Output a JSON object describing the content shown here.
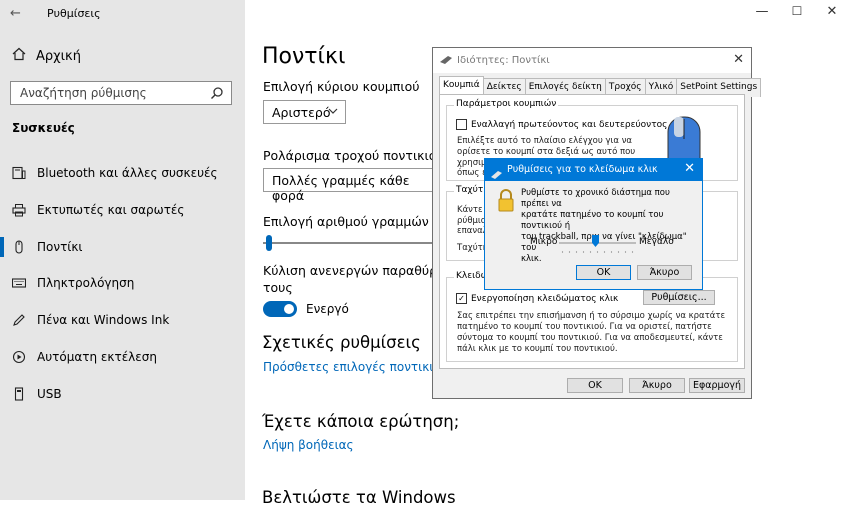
{
  "window": {
    "title": "Ρυθμίσεις",
    "controls": {
      "minimize": "—",
      "maximize": "☐",
      "close": "✕"
    }
  },
  "sidebar": {
    "home": "Αρχική",
    "search_placeholder": "Αναζήτηση ρύθμισης",
    "section": "Συσκευές",
    "items": [
      {
        "label": "Bluetooth και άλλες συσκευές",
        "icon": "bluetooth-devices-icon"
      },
      {
        "label": "Εκτυπωτές και σαρωτές",
        "icon": "printer-icon"
      },
      {
        "label": "Ποντίκι",
        "icon": "mouse-icon",
        "active": true
      },
      {
        "label": "Πληκτρολόγηση",
        "icon": "keyboard-icon"
      },
      {
        "label": "Πένα και Windows Ink",
        "icon": "pen-icon"
      },
      {
        "label": "Αυτόματη εκτέλεση",
        "icon": "autoplay-icon"
      },
      {
        "label": "USB",
        "icon": "usb-icon"
      }
    ]
  },
  "main": {
    "title": "Ποντίκι",
    "primary_button_label": "Επιλογή κύριου κουμπιού",
    "primary_button_value": "Αριστερό",
    "wheel_label": "Ρολάρισμα τροχού ποντικιού για",
    "wheel_value": "Πολλές γραμμές κάθε φορά",
    "lines_label": "Επιλογή αριθμού γραμμών κύλισ",
    "inactive_scroll_label_1": "Κύλιση ανενεργών παραθύρων ό",
    "inactive_scroll_label_2": "τους",
    "toggle_state": "Ενεργό",
    "related_heading": "Σχετικές ρυθμίσεις",
    "related_link": "Πρόσθετες επιλογές ποντικιού",
    "question_heading": "Έχετε κάποια ερώτηση;",
    "help_link": "Λήψη βοήθειας",
    "bottom_heading": "Βελτιώστε τα Windows"
  },
  "properties_dialog": {
    "title": "Ιδιότητες: Ποντίκι",
    "tabs": [
      "Κουμπιά",
      "Δείκτες",
      "Επιλογές δείκτη",
      "Τροχός",
      "Υλικό",
      "SetPoint Settings"
    ],
    "group_buttons": "Παράμετροι κουμπιών",
    "swap_checkbox": "Εναλλαγή πρωτεύοντος και δευτερεύοντος",
    "swap_desc_1": "Επιλέξτε αυτό το πλαίσιο ελέγχου για να",
    "swap_desc_2": "ορίσετε το κουμπί στα δεξιά ως αυτό που",
    "swap_desc_3": "χρησιμ",
    "swap_desc_4": "όπως ε",
    "group_speed": "Ταχύτη",
    "speed_desc_1": "Κάντε δ",
    "speed_desc_2": "ρύθμισ",
    "speed_desc_3": "επαναλ",
    "speed_label": "Ταχύτη",
    "group_lock": "Κλειδώ",
    "lock_checkbox": "Ενεργοποίηση κλειδώματος κλικ",
    "settings_button": "Ρυθμίσεις...",
    "lock_desc_1": "Σας επιτρέπει την επισήμανση ή το σύρσιμο χωρίς να κρατάτε",
    "lock_desc_2": "πατημένο το κουμπί του ποντικιού. Για να οριστεί, πατήστε",
    "lock_desc_3": "σύντομα το κουμπί του ποντικιού. Για να αποδεσμευτεί, κάντε",
    "lock_desc_4": "πάλι κλικ με το κουμπί του ποντικιού.",
    "ok": "ΟΚ",
    "cancel": "Άκυρο",
    "apply": "Εφαρμογή"
  },
  "click_lock_dialog": {
    "title": "Ρυθμίσεις για το κλείδωμα κλικ",
    "text_1": "Ρυθμίστε το χρονικό διάστημα που πρέπει να",
    "text_2": "κρατάτε πατημένο το κουμπί του ποντικιού ή",
    "text_3": "του trackball, πριν να γίνει \"κλείδωμα\" του",
    "text_4": "κλικ.",
    "min_label": "Μικρό",
    "max_label": "Μεγάλο",
    "slider_value": 0.5,
    "ok": "ΟΚ",
    "cancel": "Άκυρο"
  },
  "colors": {
    "accent": "#0078d7",
    "sidebar": "#e6e6e6",
    "link": "#0067b8"
  }
}
